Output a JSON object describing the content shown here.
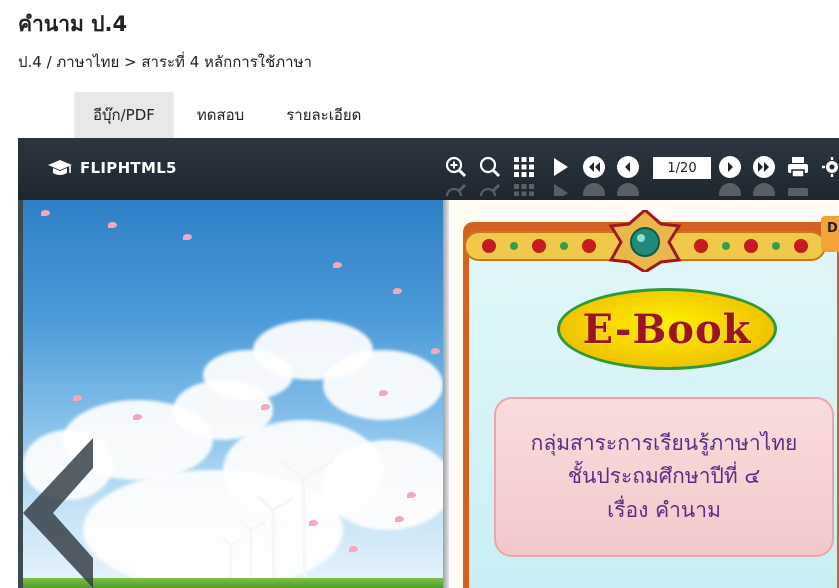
{
  "page": {
    "title": "คำนาม ป.4",
    "breadcrumb": "ป.4 / ภาษาไทย > สาระที่ 4 หลักการใช้ภาษา"
  },
  "tabs": [
    {
      "label": "อีบุ๊ก/PDF",
      "active": true
    },
    {
      "label": "ทดสอบ",
      "active": false
    },
    {
      "label": "รายละเอียด",
      "active": false
    }
  ],
  "viewer": {
    "brand": "FLIPHTML5",
    "page_indicator": "1/20",
    "tools": [
      "zoom-in-icon",
      "search-icon",
      "grid-icon",
      "play-icon",
      "first-page-icon",
      "prev-page-icon",
      "next-page-icon",
      "last-page-icon",
      "print-icon",
      "more-icon"
    ],
    "cover": {
      "badge": "E-Book",
      "line1": "กลุ่มสาระการเรียนรู้ภาษาไทย",
      "line2": "ชั้นประถมศึกษาปีที่ ๔",
      "line3": "เรื่อง คำนาม"
    },
    "next_page_tab": "D"
  },
  "colors": {
    "toolbar": "#1e272e",
    "active_tab": "#e7e7e7",
    "frame": "#d4611f",
    "badge_text": "#9b1520",
    "box_text": "#5b2e86"
  }
}
